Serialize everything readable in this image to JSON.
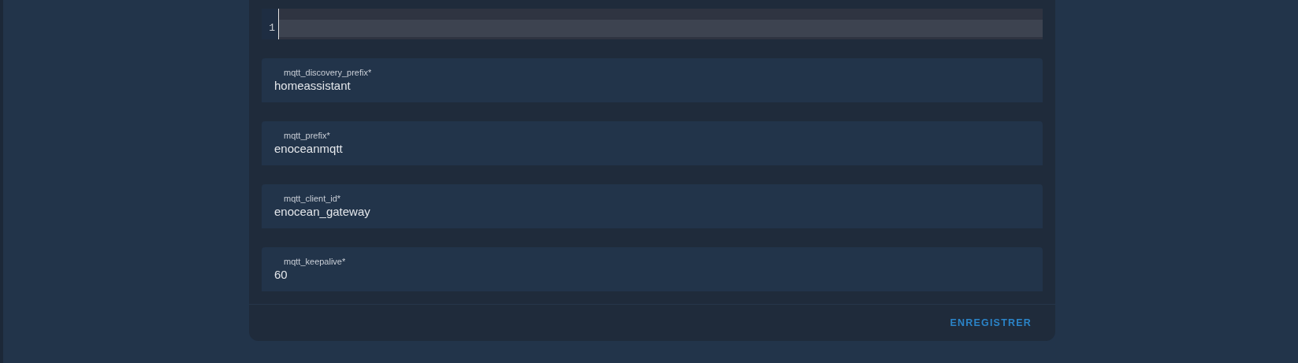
{
  "editor": {
    "line_numbers": [
      "1"
    ]
  },
  "fields": [
    {
      "label": "mqtt_discovery_prefix*",
      "value": "homeassistant"
    },
    {
      "label": "mqtt_prefix*",
      "value": "enoceanmqtt"
    },
    {
      "label": "mqtt_client_id*",
      "value": "enocean_gateway"
    },
    {
      "label": "mqtt_keepalive*",
      "value": "60"
    }
  ],
  "actions": {
    "save": "ENREGISTRER"
  }
}
